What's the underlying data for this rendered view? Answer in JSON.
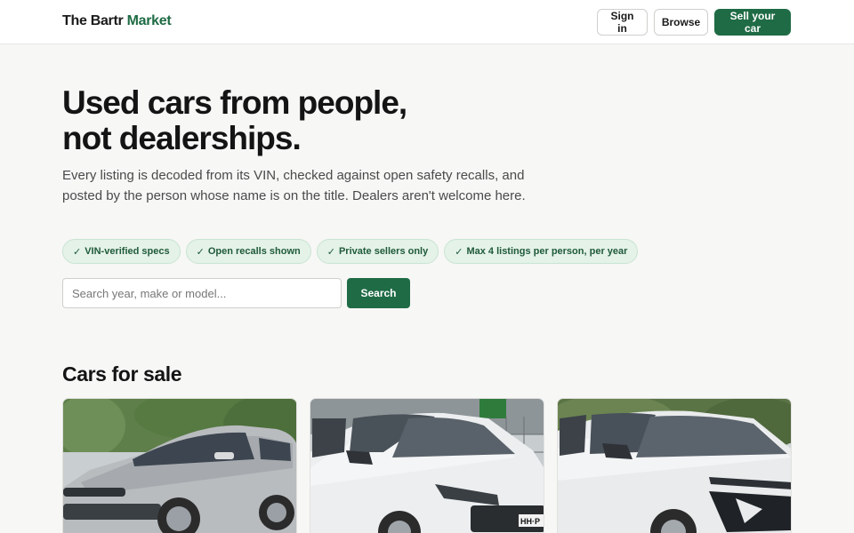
{
  "header": {
    "brand_part1": "The Bartr",
    "brand_part2": "Market",
    "signin_label": "Sign in",
    "browse_label": "Browse",
    "sell_label": "Sell your car"
  },
  "hero": {
    "title_line1": "Used cars from people,",
    "title_line2": "not dealerships.",
    "subtitle": "Every listing is decoded from its VIN, checked against open safety recalls, and posted by the person whose name is on the title. Dealers aren't welcome here.",
    "pills": [
      {
        "check": "✓",
        "label": "VIN-verified specs"
      },
      {
        "check": "✓",
        "label": "Open recalls shown"
      },
      {
        "check": "✓",
        "label": "Private sellers only"
      },
      {
        "check": "✓",
        "label": "Max 4 listings per person, per year"
      }
    ]
  },
  "search": {
    "placeholder": "Search year, make or model...",
    "value": "",
    "button_label": "Search"
  },
  "listings": {
    "title": "Cars for sale",
    "cards": [
      {
        "photo_icon": "silver-sedan-photo",
        "plate_text": ""
      },
      {
        "photo_icon": "white-hatchback-photo",
        "plate_text": "HH·P"
      },
      {
        "photo_icon": "white-sedan-photo",
        "plate_text": ""
      }
    ]
  },
  "colors": {
    "accent": "#1f6b45",
    "pill_bg": "#e4f2e8",
    "page_bg": "#f7f7f6"
  }
}
